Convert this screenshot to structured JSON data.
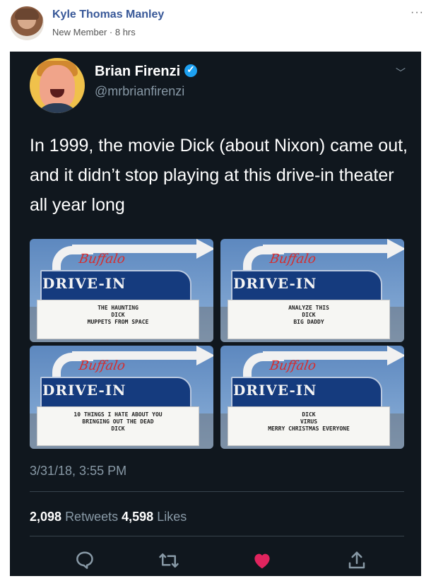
{
  "post": {
    "author": "Kyle Thomas Manley",
    "meta": "New Member · 8 hrs",
    "more": "···"
  },
  "tweet": {
    "name": "Brian Firenzi",
    "handle": "@mrbrianfirenzi",
    "text": "In 1999, the movie Dick (about Nixon) came out, and it didn’t stop playing at this drive-in theater all year long",
    "timestamp": "3/31/18, 3:55 PM",
    "retweets": "2,098",
    "retweets_label": "Retweets",
    "likes": "4,598",
    "likes_label": "Likes",
    "chevron": "﹀"
  },
  "theater": {
    "script": "Buffalo",
    "drive_in": "DRIVE-IN"
  },
  "signs": [
    [
      "THE HAUNTING",
      "DICK",
      "MUPPETS FROM SPACE"
    ],
    [
      "ANALYZE THIS",
      "DICK",
      "BIG DADDY"
    ],
    [
      "10 THINGS I HATE ABOUT YOU",
      "BRINGING OUT THE DEAD",
      "DICK"
    ],
    [
      "DICK",
      "VIRUS",
      "MERRY CHRISTMAS EVERYONE"
    ]
  ],
  "colors": {
    "tweet_bg": "#10171e",
    "secondary": "#8899a6",
    "like": "#e0245e",
    "fb_blue": "#385898"
  },
  "icons": [
    "reply-icon",
    "retweet-icon",
    "heart-icon",
    "share-icon"
  ]
}
